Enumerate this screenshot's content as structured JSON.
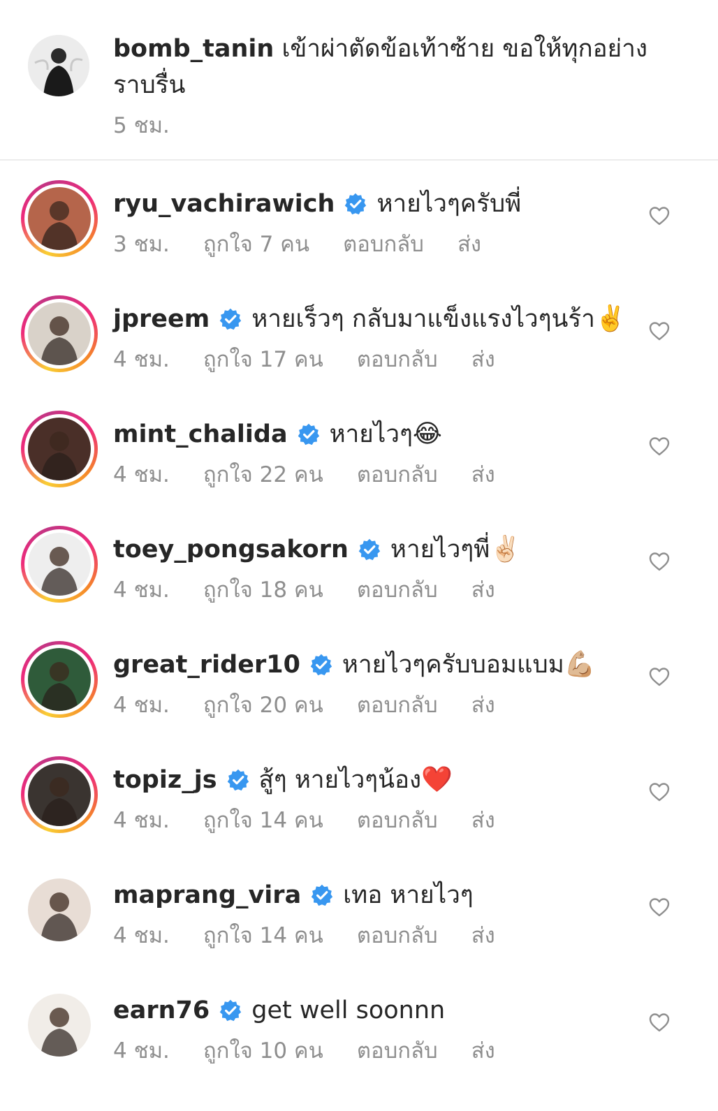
{
  "caption": {
    "username": "bomb_tanin",
    "text": "เข้าผ่าตัดข้อเท้าซ้าย ขอให้ทุกอย่างราบรื่น",
    "time": "5 ชม."
  },
  "comments": [
    {
      "username": "ryu_vachirawich",
      "verified": true,
      "text": "หายไวๆครับพี่",
      "emoji": "",
      "time": "3 ชม.",
      "likes": "ถูกใจ 7 คน",
      "reply": "ตอบกลับ",
      "send": "ส่ง",
      "story_ring": true,
      "avatar_color": "#b5654b"
    },
    {
      "username": "jpreem",
      "verified": true,
      "text": "หายเร็วๆ กลับมาแข็งแรงไวๆนร้า",
      "emoji": "✌️",
      "time": "4 ชม.",
      "likes": "ถูกใจ 17 คน",
      "reply": "ตอบกลับ",
      "send": "ส่ง",
      "story_ring": true,
      "avatar_color": "#d9d2c9"
    },
    {
      "username": "mint_chalida",
      "verified": true,
      "text": "หายไวๆ",
      "emoji": "😂",
      "time": "4 ชม.",
      "likes": "ถูกใจ 22 คน",
      "reply": "ตอบกลับ",
      "send": "ส่ง",
      "story_ring": true,
      "avatar_color": "#4a2f28"
    },
    {
      "username": "toey_pongsakorn",
      "verified": true,
      "text": "หายไวๆพี่",
      "emoji": "✌🏻",
      "time": "4 ชม.",
      "likes": "ถูกใจ 18 คน",
      "reply": "ตอบกลับ",
      "send": "ส่ง",
      "story_ring": true,
      "avatar_color": "#eeeeee"
    },
    {
      "username": "great_rider10",
      "verified": true,
      "text": "หายไวๆครับบอมแบม",
      "emoji": "💪🏼",
      "time": "4 ชม.",
      "likes": "ถูกใจ 20 คน",
      "reply": "ตอบกลับ",
      "send": "ส่ง",
      "story_ring": true,
      "avatar_color": "#2f5b3a"
    },
    {
      "username": "topiz_js",
      "verified": true,
      "text": "สู้ๆ หายไวๆน้อง",
      "emoji": "❤️",
      "time": "4 ชม.",
      "likes": "ถูกใจ 14 คน",
      "reply": "ตอบกลับ",
      "send": "ส่ง",
      "story_ring": true,
      "avatar_color": "#3a3430"
    },
    {
      "username": "maprang_vira",
      "verified": true,
      "text": "เทอ หายไวๆ",
      "emoji": "",
      "time": "4 ชม.",
      "likes": "ถูกใจ 14 คน",
      "reply": "ตอบกลับ",
      "send": "ส่ง",
      "story_ring": false,
      "avatar_color": "#e8ddd5"
    },
    {
      "username": "earn76",
      "verified": true,
      "text": "get well soonnn",
      "emoji": "",
      "time": "4 ชม.",
      "likes": "ถูกใจ 10 คน",
      "reply": "ตอบกลับ",
      "send": "ส่ง",
      "story_ring": false,
      "avatar_color": "#f1ede8"
    }
  ],
  "colors": {
    "verified": "#3897f0",
    "muted": "#8e8e8e",
    "text": "#262626"
  }
}
